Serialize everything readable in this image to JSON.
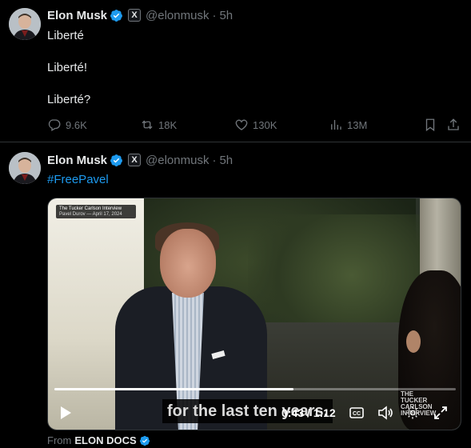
{
  "colors": {
    "accent": "#1d9bf0",
    "muted": "#71767b",
    "text": "#e7e9ea",
    "background": "#000000",
    "divider": "#2f3336"
  },
  "tweets": [
    {
      "author": {
        "name": "Elon Musk",
        "handle": "@elonmusk",
        "time": "5h",
        "badge_label": "X"
      },
      "lines": [
        "Liberté",
        "Liberté!",
        "Liberté?"
      ],
      "stats": {
        "replies": "9.6K",
        "retweets": "18K",
        "likes": "130K",
        "views": "13M"
      }
    },
    {
      "author": {
        "name": "Elon Musk",
        "handle": "@elonmusk",
        "time": "5h",
        "badge_label": "X"
      },
      "hashtag": "#FreePavel",
      "video": {
        "title_card_line1": "The Tucker Carlson Interview",
        "title_card_line2": "Pavel Durov — April 17, 2024",
        "watermark": [
          "THE",
          "TUCKER",
          "CARLSON",
          "INTERVIEW"
        ],
        "subtitle": "for the last ten years.",
        "timecode": "0:43 / 1:12",
        "progress": 0.595
      },
      "from_label": "From",
      "source": "ELON DOCS"
    }
  ],
  "icons": {
    "reply": "reply-icon",
    "retweet": "retweet-icon",
    "like": "heart-icon",
    "views": "views-icon",
    "bookmark": "bookmark-icon",
    "share": "share-icon",
    "verified": "verified-badge-icon",
    "play": "play-icon",
    "cc": "captions-icon",
    "volume": "volume-icon",
    "settings": "settings-icon",
    "fullscreen": "fullscreen-icon"
  }
}
